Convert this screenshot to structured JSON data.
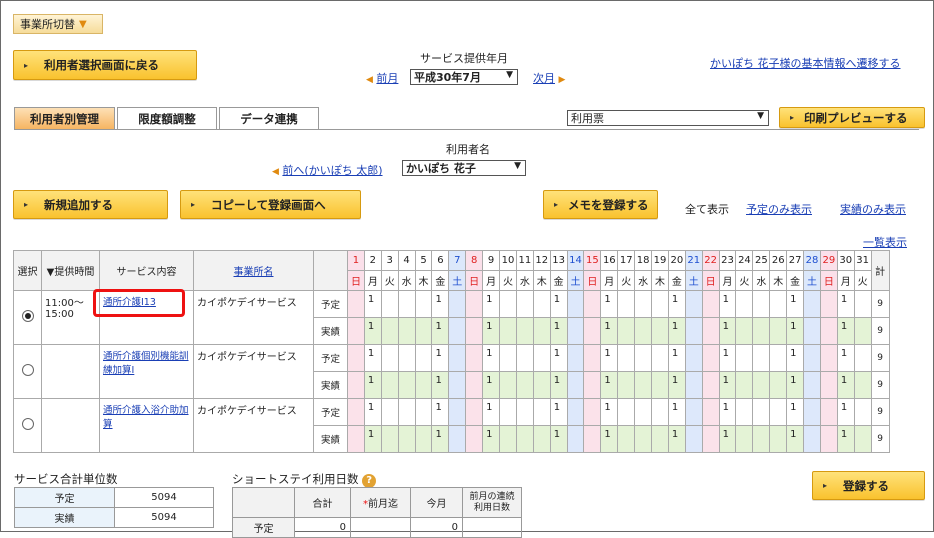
{
  "office_switch": "事業所切替",
  "back_button": "利用者選択画面に戻る",
  "service_month_label": "サービス提供年月",
  "prev_month": "前月",
  "month_select": "平成30年7月",
  "next_month": "次月",
  "basic_info_link": "かいぽち 花子様の基本情報へ遷移する",
  "tabs": [
    "利用者別管理",
    "限度額調整",
    "データ連携"
  ],
  "report_select": "利用票",
  "print_preview": "印刷プレビューする",
  "user_name_label": "利用者名",
  "prev_user": "前へ(かいぽち 太郎)",
  "user_select": "かいぽち 花子",
  "add_new": "新規追加する",
  "copy_register": "コピーして登録画面へ",
  "memo_register": "メモを登録する",
  "show_all": "全て表示",
  "show_plan": "予定のみ表示",
  "show_actual": "実績のみ表示",
  "list_view": "一覧表示",
  "grid": {
    "col_select": "選択",
    "col_time": "▼提供時間",
    "col_service": "サービス内容",
    "col_office": "事業所名",
    "col_total": "計",
    "days": [
      "1",
      "2",
      "3",
      "4",
      "5",
      "6",
      "7",
      "8",
      "9",
      "10",
      "11",
      "12",
      "13",
      "14",
      "15",
      "16",
      "17",
      "18",
      "19",
      "20",
      "21",
      "22",
      "23",
      "24",
      "25",
      "26",
      "27",
      "28",
      "29",
      "30",
      "31"
    ],
    "weekdays": [
      "日",
      "月",
      "火",
      "水",
      "木",
      "金",
      "土",
      "日",
      "月",
      "火",
      "水",
      "木",
      "金",
      "土",
      "日",
      "月",
      "火",
      "水",
      "木",
      "金",
      "土",
      "日",
      "月",
      "火",
      "水",
      "木",
      "金",
      "土",
      "日",
      "月",
      "火"
    ],
    "plan_label": "予定",
    "actual_label": "実績",
    "rows": [
      {
        "time": "11:00～\n15:00",
        "service": "通所介護Ⅰ13",
        "office": "カイポケデイサービス",
        "total_plan": "9",
        "total_actual": "9",
        "selected": true
      },
      {
        "time": "",
        "service": "通所介護個別機能訓練加算Ⅰ",
        "office": "カイポケデイサービス",
        "total_plan": "9",
        "total_actual": "9",
        "selected": false
      },
      {
        "time": "",
        "service": "通所介護入浴介助加算",
        "office": "カイポケデイサービス",
        "total_plan": "9",
        "total_actual": "9",
        "selected": false
      }
    ],
    "one_days": [
      2,
      6,
      9,
      13,
      16,
      20,
      23,
      27,
      30
    ],
    "one": "1"
  },
  "summary": {
    "title": "サービス合計単位数",
    "plan_label": "予定",
    "plan_value": "5094",
    "actual_label": "実績",
    "actual_value": "5094"
  },
  "short_stay": {
    "title": "ショートステイ利用日数",
    "col_total": "合計",
    "col_prev": "前月迄",
    "col_this": "今月",
    "col_cont": "前月の連続\n利用日数",
    "row_plan": "予定",
    "plan_total": "0",
    "plan_this": "0"
  },
  "register_button": "登録する"
}
